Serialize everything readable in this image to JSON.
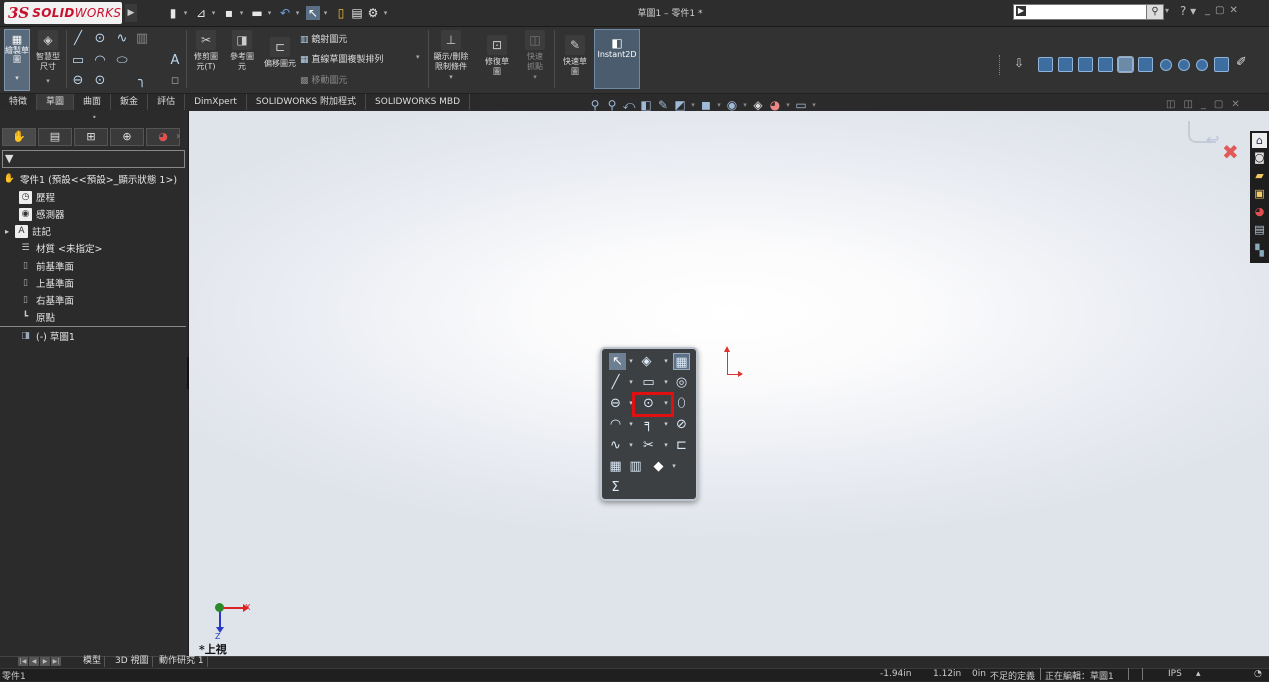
{
  "app": {
    "brand_ds": "3S",
    "brand_name": "SOLID",
    "brand_name2": "WORKS",
    "window_title": "草圖1 – 零件1 *"
  },
  "quick_access": [
    "new-icon",
    "open-icon",
    "save-icon",
    "print-icon",
    "undo-icon",
    "select-icon",
    "rebuild-icon",
    "file-props-icon",
    "options-icon"
  ],
  "ribbon": {
    "sketch": "繪製草圖",
    "smart_dim": "智慧型尺寸",
    "trim": "修剪圖元(T)",
    "convert": "參考圖元",
    "offset": "偏移圖元",
    "mirror": "鏡射圖元",
    "linear_pattern": "直線草圖複製排列",
    "move": "移動圖元",
    "relations": "顯示/刪除限制條件",
    "repair": "修復草圖",
    "quick_snaps": "快速抓點",
    "rapid_sketch": "快速草圖",
    "instant2d": "Instant2D"
  },
  "tabs": [
    {
      "label": "特徵"
    },
    {
      "label": "草圖"
    },
    {
      "label": "曲面"
    },
    {
      "label": "鈑金"
    },
    {
      "label": "評估"
    },
    {
      "label": "DimXpert"
    },
    {
      "label": "SOLIDWORKS 附加程式"
    },
    {
      "label": "SOLIDWORKS MBD"
    }
  ],
  "tree": {
    "root": "零件1 (預設<<預設>_顯示狀態 1>)",
    "items": [
      {
        "label": "歷程"
      },
      {
        "label": "感測器"
      },
      {
        "label": "註記"
      },
      {
        "label": "材質 <未指定>"
      },
      {
        "label": "前基準面"
      },
      {
        "label": "上基準面"
      },
      {
        "label": "右基準面"
      },
      {
        "label": "原點"
      },
      {
        "label": "(-) 草圖1"
      }
    ]
  },
  "triad": {
    "x": "X",
    "z": "Z"
  },
  "view_name": "*上視",
  "bottom_tabs": [
    "模型",
    "3D 視圖",
    "動作研究 1"
  ],
  "status": {
    "left": "零件1",
    "x_coord": "-1.94in",
    "y_coord": "1.12in",
    "z_coord": "0in",
    "definition": "不足的定義",
    "editing": "正在編輯：草圖1",
    "units": "IPS"
  },
  "colors": {
    "highlight_box": "#e01010",
    "accent_blue": "#4a6c8c",
    "origin_red": "#dd3333"
  }
}
